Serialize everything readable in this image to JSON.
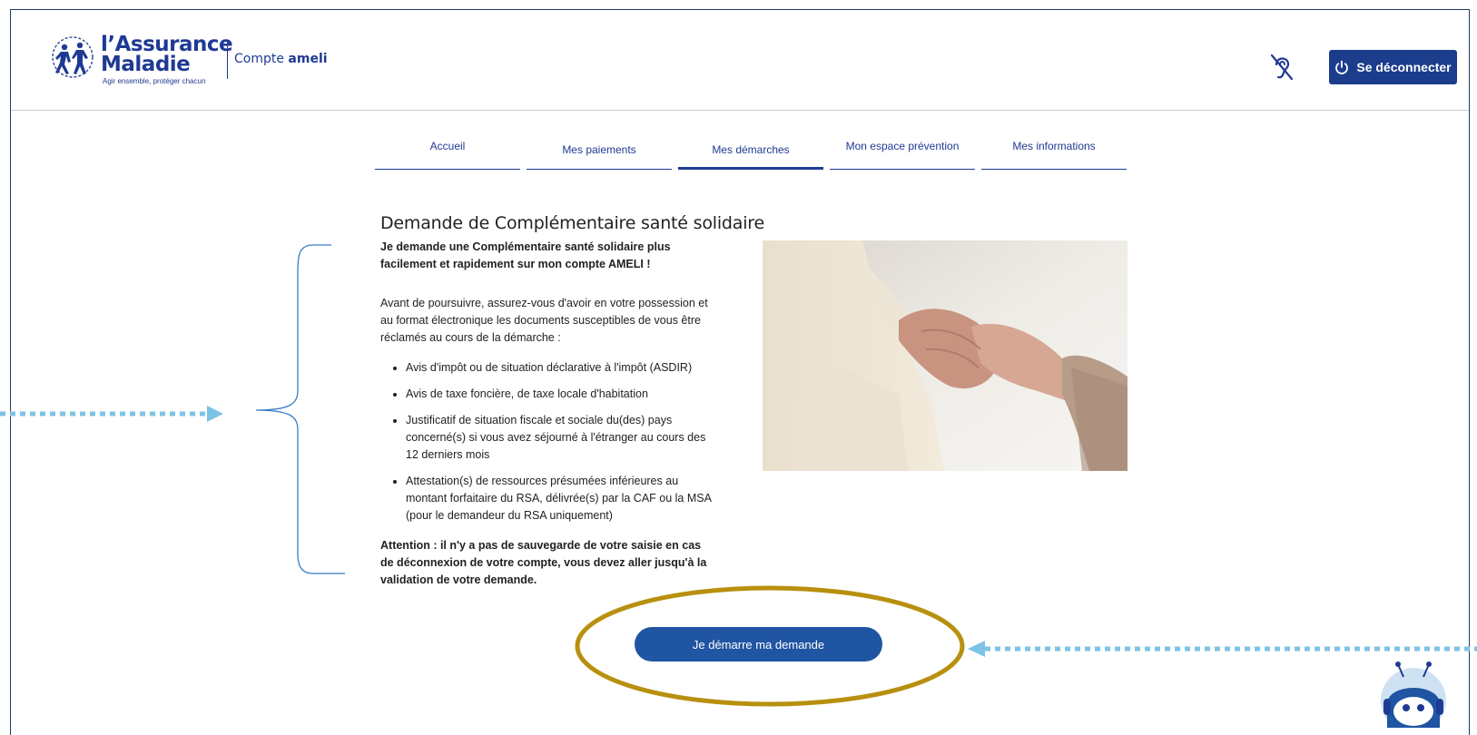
{
  "header": {
    "logo_line1": "l’Assurance",
    "logo_line2": "Maladie",
    "logo_tagline": "Agir ensemble, protéger chacun",
    "compte_prefix": "Compte",
    "compte_brand": "ameli",
    "logout_label": "Se déconnecter"
  },
  "nav": {
    "tabs": [
      {
        "label": "Accueil",
        "active": false
      },
      {
        "label": "Mes paiements",
        "active": false
      },
      {
        "label": "Mes démarches",
        "active": true
      },
      {
        "label": "Mon espace prévention",
        "active": false
      },
      {
        "label": "Mes informations",
        "active": false
      }
    ]
  },
  "main": {
    "title": "Demande de Complémentaire santé solidaire",
    "intro": "Je demande une Complémentaire santé solidaire plus facilement et rapidement sur mon compte AMELI !",
    "lead": "Avant de poursuivre, assurez-vous d'avoir en votre possession et au format électronique les documents susceptibles de vous être réclamés au cours de la démarche :",
    "documents": [
      "Avis d'impôt ou de situation déclarative à l'impôt (ASDIR)",
      "Avis de taxe foncière, de taxe locale d'habitation",
      "Justificatif de situation fiscale et sociale du(des) pays concerné(s) si vous avez séjourné à l'étranger au cours des 12 derniers mois",
      "Attestation(s) de ressources présumées inférieures au montant forfaitaire du RSA, délivrée(s) par la CAF ou la MSA (pour le demandeur du RSA uniquement)"
    ],
    "warning": "Attention : il n'y a pas de sauvegarde de votre saisie en cas de déconnexion de votre compte, vous devez aller jusqu'à la validation de votre demande.",
    "start_label": "Je démarre ma demande"
  },
  "colors": {
    "brand_blue": "#1f3a93",
    "button_blue": "#1f55a2",
    "annotation_gold": "#b8900f",
    "annotation_arrow": "#7cc3e6"
  },
  "icons": {
    "hearing": "ear-slash-icon",
    "logout": "power-icon",
    "chatbot": "chatbot-avatar-icon"
  }
}
